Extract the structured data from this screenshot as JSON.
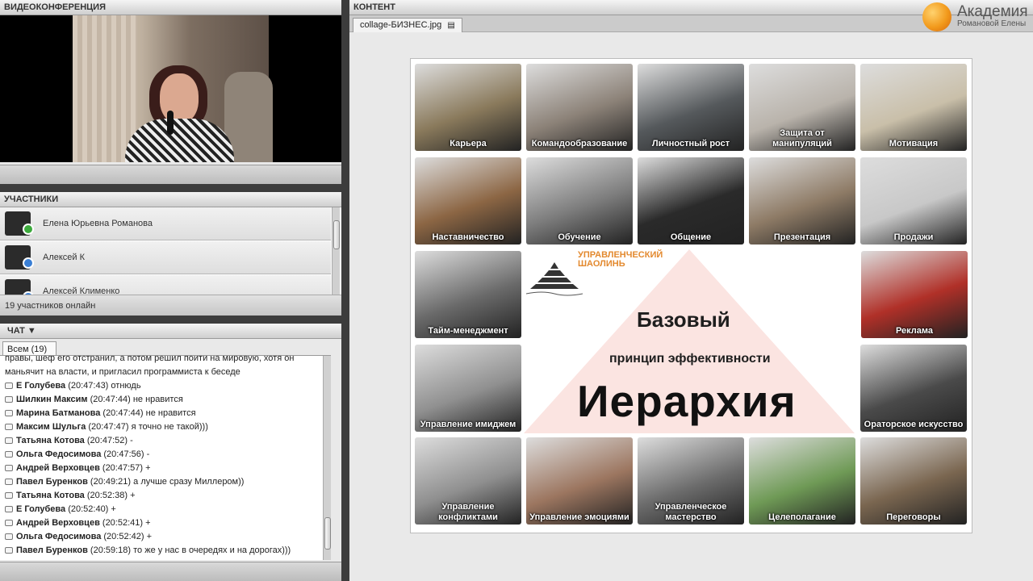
{
  "video": {
    "header": "ВИДЕОКОНФЕРЕНЦИЯ"
  },
  "participants": {
    "header": "УЧАСТНИКИ",
    "list": [
      {
        "name": "Елена Юрьевна Романова",
        "badge_color": "#3caa3c"
      },
      {
        "name": "Алексей К",
        "badge_color": "#3a7fd5"
      },
      {
        "name": "Алексей Клименко",
        "badge_color": "#3a7fd5"
      }
    ],
    "online": "19 участников онлайн"
  },
  "chat": {
    "header": "ЧАТ ▼",
    "tab": "Всем (19)",
    "wrap_lines": [
      "правы, шеф его отстранил, а потом решил пойти на мировую, хотя он",
      "маньячит на власти, и пригласил программиста к беседе"
    ],
    "messages": [
      {
        "author": "Е Голубева",
        "time": "(20:47:43)",
        "text": "отнюдь"
      },
      {
        "author": "Шилкин Максим",
        "time": "(20:47:44)",
        "text": "не нравится"
      },
      {
        "author": "Марина Батманова",
        "time": "(20:47:44)",
        "text": "не нравится"
      },
      {
        "author": "Максим Шульга",
        "time": "(20:47:47)",
        "text": "я точно не такой)))"
      },
      {
        "author": "Татьяна Котова",
        "time": "(20:47:52)",
        "text": "-"
      },
      {
        "author": "Ольга Федосимова",
        "time": "(20:47:56)",
        "text": "-"
      },
      {
        "author": "Андрей Верховцев",
        "time": "(20:47:57)",
        "text": "+"
      },
      {
        "author": "Павел Буренков",
        "time": "(20:49:21)",
        "text": "а лучше сразу Миллером))"
      },
      {
        "author": "Татьяна Котова",
        "time": "(20:52:38)",
        "text": "+"
      },
      {
        "author": "Е Голубева",
        "time": "(20:52:40)",
        "text": "+"
      },
      {
        "author": "Андрей Верховцев",
        "time": "(20:52:41)",
        "text": "+"
      },
      {
        "author": "Ольга Федосимова",
        "time": "(20:52:42)",
        "text": "+"
      },
      {
        "author": "Павел Буренков",
        "time": "(20:59:18)",
        "text": "то же у нас в очередях и на дорогах)))"
      }
    ]
  },
  "content": {
    "header": "КОНТЕНТ",
    "file_tab": "collage-БИЗНЕС.jpg",
    "file_icon": "document-icon"
  },
  "brand": {
    "name": "Академия",
    "sub": "Романовой Елены",
    "color": "#f29a1c"
  },
  "slide": {
    "school": "УПРАВЛЕНЧЕСКИЙ ШАОЛИНЬ",
    "title1": "Базовый",
    "title2": "принцип эффективности",
    "title3": "Иерархия",
    "tiles": [
      {
        "label": "Карьера",
        "color": "#8a7a5c"
      },
      {
        "label": "Командообразование",
        "color": "#8c8278"
      },
      {
        "label": "Личностный рост",
        "color": "#55595c"
      },
      {
        "label": "Защита от манипуляций",
        "color": "#b9b3ab"
      },
      {
        "label": "Мотивация",
        "color": "#c9bfa9"
      },
      {
        "label": "Наставничество",
        "color": "#8c6644"
      },
      {
        "label": "Обучение",
        "color": "#7d7d7d"
      },
      {
        "label": "Общение",
        "color": "#2a2a2a"
      },
      {
        "label": "Презентация",
        "color": "#8e7b66"
      },
      {
        "label": "Продажи",
        "color": "#c8c8c8"
      },
      {
        "label": "Тайм-менеджмент",
        "color": "#6a6a6a"
      },
      {
        "label": "Реклама",
        "color": "#b03028"
      },
      {
        "label": "Управление имиджем",
        "color": "#909090"
      },
      {
        "label": "Ораторское искусство",
        "color": "#4a4a4a"
      },
      {
        "label": "Управление конфликтами",
        "color": "#8f8f8f"
      },
      {
        "label": "Управление эмоциями",
        "color": "#9c7660"
      },
      {
        "label": "Управленческое мастерство",
        "color": "#6c6c6c"
      },
      {
        "label": "Целеполагание",
        "color": "#6f9a56"
      },
      {
        "label": "Переговоры",
        "color": "#7a6650"
      }
    ]
  }
}
